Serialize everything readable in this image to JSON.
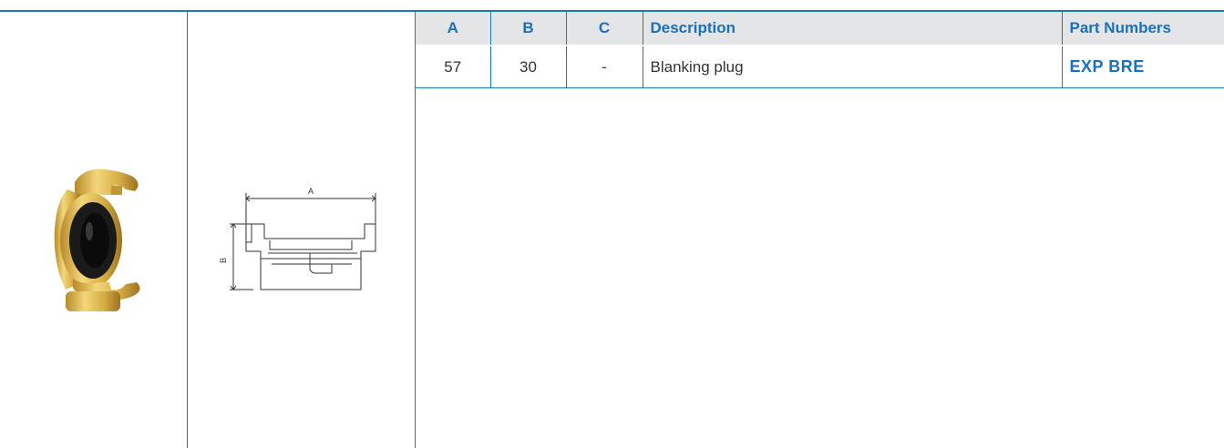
{
  "table": {
    "headers": [
      "A",
      "B",
      "C",
      "Description",
      "Part Numbers"
    ],
    "rows": [
      {
        "a": "57",
        "b": "30",
        "c": "-",
        "description": "Blanking plug",
        "part_number": "EXP BRE"
      }
    ]
  },
  "drawing": {
    "dim_a_label": "A",
    "dim_b_label": "B"
  },
  "colors": {
    "accent": "#1a7ab9",
    "header_bg": "#e3e5e7",
    "header_text": "#1a6fbf",
    "part_number": "#1a6fbf",
    "brass": "#d9b44a"
  }
}
